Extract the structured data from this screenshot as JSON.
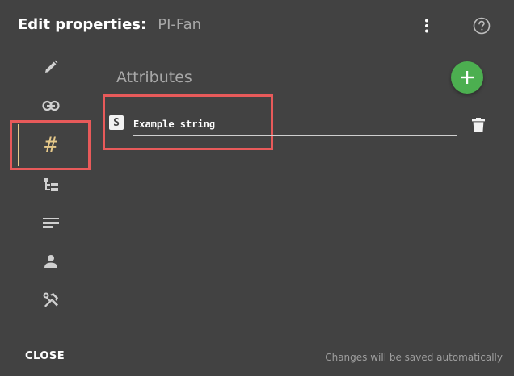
{
  "header": {
    "title_label": "Edit properties:",
    "object_name": "PI-Fan",
    "menu_icon": "more-vert-icon",
    "help_icon": "help-circle-icon"
  },
  "sidebar": {
    "items": [
      {
        "icon": "pencil-icon",
        "active": false
      },
      {
        "icon": "link-icon",
        "active": false
      },
      {
        "icon": "hash-icon",
        "label": "#",
        "active": true
      },
      {
        "icon": "hierarchy-icon",
        "active": false
      },
      {
        "icon": "notes-icon",
        "active": false
      },
      {
        "icon": "person-icon",
        "active": false
      },
      {
        "icon": "tools-icon",
        "active": false
      }
    ],
    "accent_color": "#e6c98a"
  },
  "main": {
    "section_title": "Attributes",
    "add_icon": "plus-icon",
    "attributes": [
      {
        "type_badge": "S",
        "value": "Example string",
        "delete_icon": "trash-icon"
      }
    ]
  },
  "footer": {
    "close_label": "CLOSE",
    "note": "Changes will be saved automatically"
  },
  "colors": {
    "background": "#424242",
    "add_button": "#4caf50",
    "highlight": "#e85a5a"
  }
}
